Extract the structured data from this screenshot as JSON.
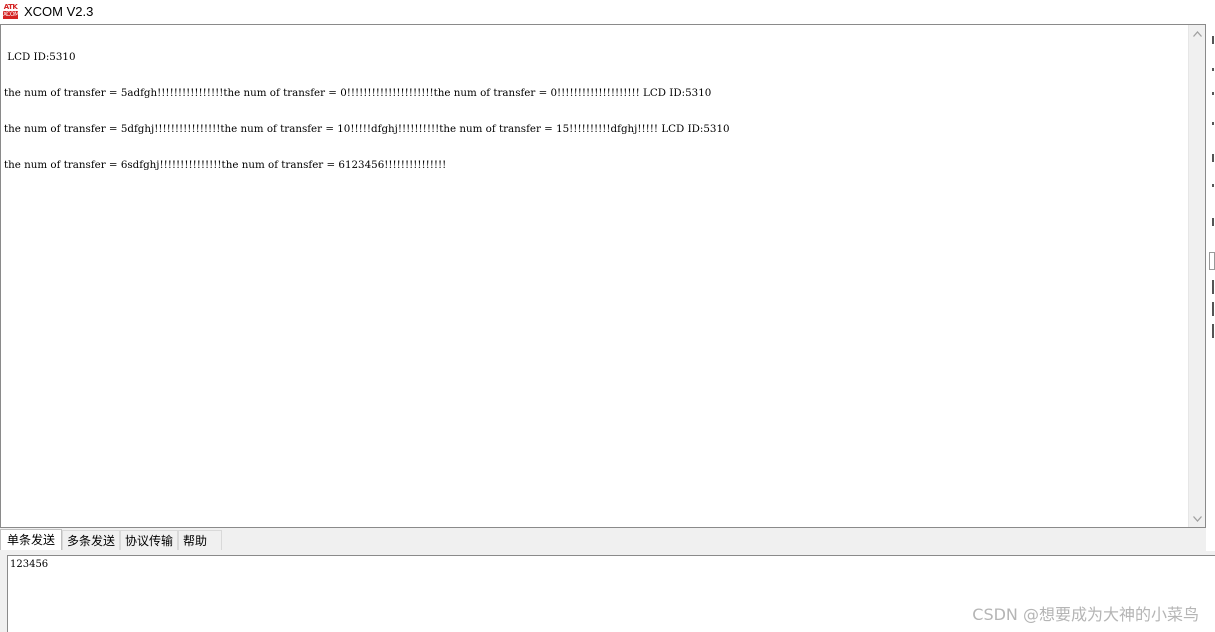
{
  "window": {
    "title": "XCOM V2.3",
    "logo_top": "ATK",
    "logo_bottom": "XCOM"
  },
  "receive": {
    "lines": [
      " LCD ID:5310",
      "the num of transfer = 5adfgh!!!!!!!!!!!!!!!!the num of transfer = 0!!!!!!!!!!!!!!!!!!!!!the num of transfer = 0!!!!!!!!!!!!!!!!!!!! LCD ID:5310",
      "the num of transfer = 5dfghj!!!!!!!!!!!!!!!!the num of transfer = 10!!!!!dfghj!!!!!!!!!!the num of transfer = 15!!!!!!!!!!dfghj!!!!! LCD ID:5310",
      "the num of transfer = 6sdfghj!!!!!!!!!!!!!!!the num of transfer = 6123456!!!!!!!!!!!!!!!"
    ]
  },
  "tabs": [
    {
      "label": "单条发送",
      "active": true
    },
    {
      "label": "多条发送",
      "active": false
    },
    {
      "label": "协议传输",
      "active": false
    },
    {
      "label": "帮助",
      "active": false
    }
  ],
  "send": {
    "value": "123456"
  },
  "watermark": "CSDN @想要成为大神的小菜鸟",
  "icons": {
    "scroll_up": "chevron-up-icon",
    "scroll_down": "chevron-down-icon",
    "app_logo": "atk-xcom-logo-icon"
  },
  "colors": {
    "logo_red": "#d42323",
    "pane_border": "#8a8a8a",
    "background": "#f0f0f0"
  }
}
